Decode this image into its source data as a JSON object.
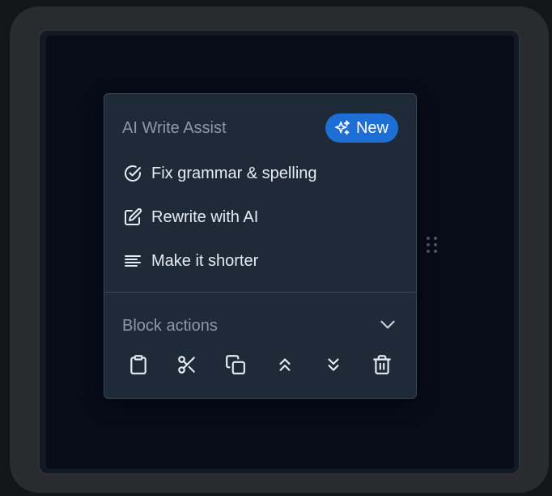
{
  "menu": {
    "title": "AI Write Assist",
    "badge_label": "New",
    "items": [
      {
        "label": "Fix grammar & spelling",
        "icon": "check-circle-icon"
      },
      {
        "label": "Rewrite with AI",
        "icon": "edit-icon"
      },
      {
        "label": "Make it shorter",
        "icon": "text-lines-icon"
      }
    ],
    "section": {
      "title": "Block actions",
      "actions": [
        {
          "icon": "clipboard-icon"
        },
        {
          "icon": "scissors-icon"
        },
        {
          "icon": "copy-icon"
        },
        {
          "icon": "move-up-icon"
        },
        {
          "icon": "move-down-icon"
        },
        {
          "icon": "trash-icon"
        }
      ]
    }
  },
  "colors": {
    "accent": "#1d6fd6",
    "menu_bg": "#1f2a38",
    "canvas_bg": "#070c18"
  }
}
